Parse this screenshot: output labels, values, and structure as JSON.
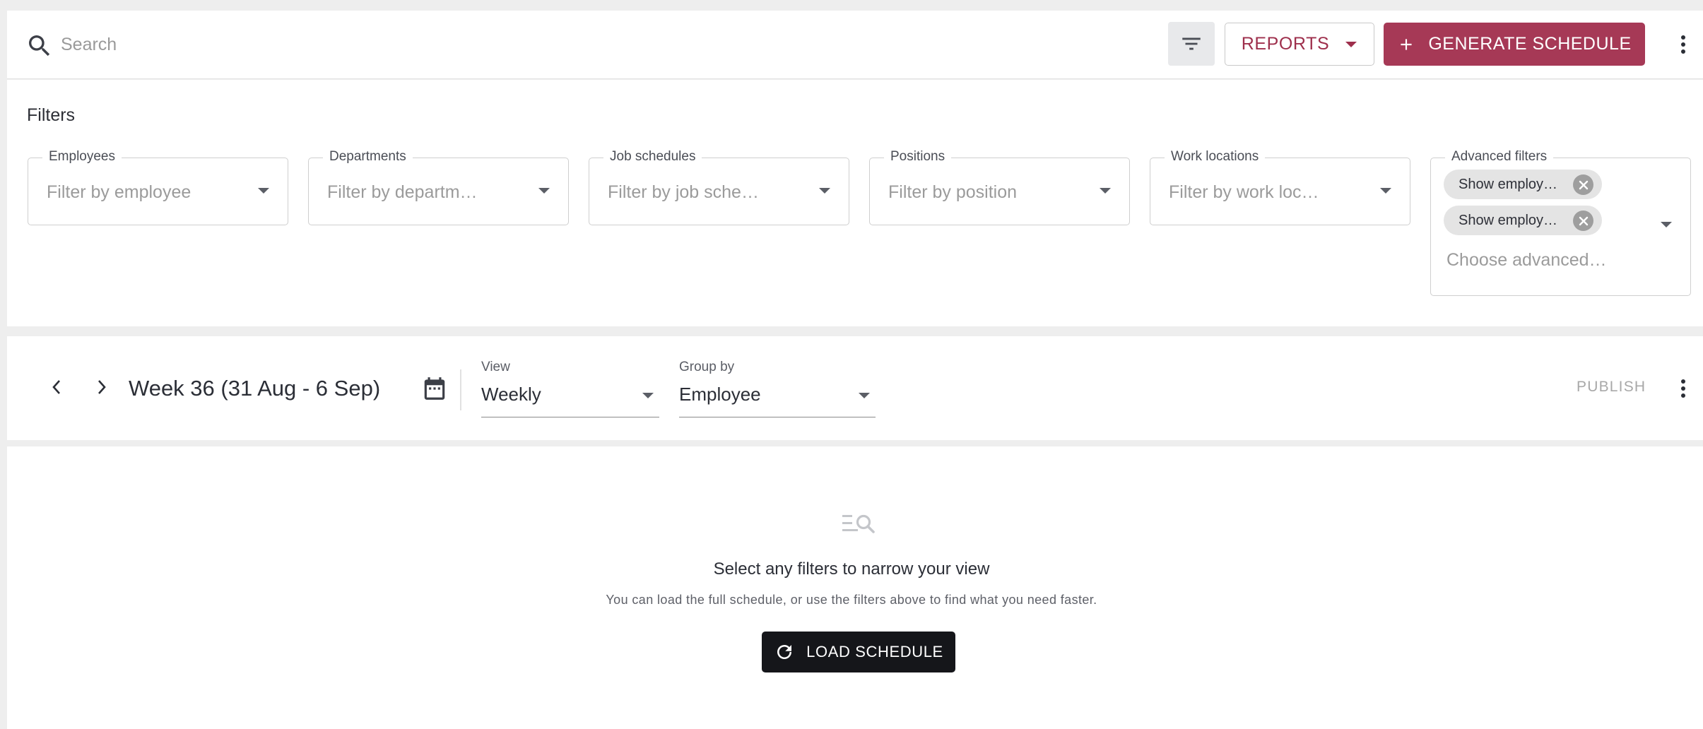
{
  "toolbar": {
    "search_placeholder": "Search",
    "reports_label": "REPORTS",
    "generate_label": "GENERATE SCHEDULE"
  },
  "filters": {
    "title": "Filters",
    "fields": [
      {
        "label": "Employees",
        "placeholder": "Filter by employee"
      },
      {
        "label": "Departments",
        "placeholder": "Filter by departm…"
      },
      {
        "label": "Job schedules",
        "placeholder": "Filter by job sche…"
      },
      {
        "label": "Positions",
        "placeholder": "Filter by position"
      },
      {
        "label": "Work locations",
        "placeholder": "Filter by work loc…"
      }
    ],
    "advanced": {
      "label": "Advanced filters",
      "chips": [
        "Show employ…",
        "Show employ…"
      ],
      "placeholder": "Choose advanced…"
    }
  },
  "schedule": {
    "week_title": "Week 36 (31 Aug - 6 Sep)",
    "view_label": "View",
    "view_value": "Weekly",
    "group_label": "Group by",
    "group_value": "Employee",
    "publish_label": "PUBLISH"
  },
  "empty_state": {
    "title": "Select any filters to narrow your view",
    "subtitle": "You can load the full schedule, or use the filters above to find what you need faster.",
    "load_label": "LOAD SCHEDULE"
  },
  "colors": {
    "brand": "#a63956",
    "brand_text": "#9e2f4c",
    "dark_button": "#15161a"
  }
}
